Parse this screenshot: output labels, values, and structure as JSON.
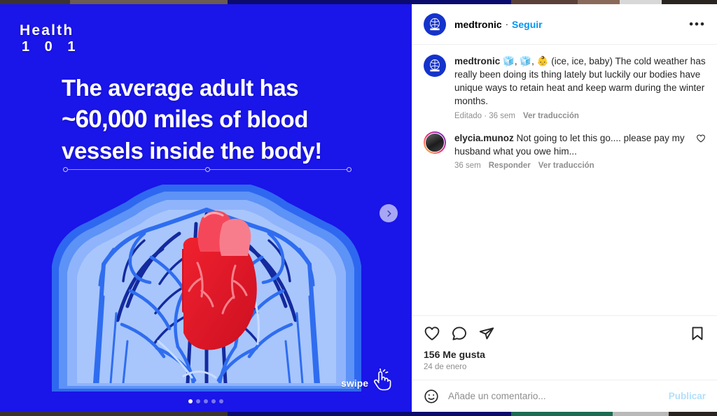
{
  "post": {
    "logo_line1": "Health",
    "logo_line2": "1 0 1",
    "headline_part1": "The average adult has",
    "headline_emphasis": "~60,000 miles",
    "headline_part2": " of blood",
    "headline_part3": "vessels inside the body!",
    "swipe_label": "swipe",
    "background_color": "#1a15e8",
    "heart_color": "#e8152b",
    "carousel": {
      "total": 5,
      "active_index": 0
    }
  },
  "header": {
    "username": "medtronic",
    "separator": "·",
    "follow_label": "Seguir",
    "more_label": "•••"
  },
  "caption": {
    "username": "medtronic",
    "text": "🧊, 🧊, 👶 (ice, ice, baby) The cold weather has really been doing its thing lately but luckily our bodies have unique ways to retain heat and keep warm during the winter months.",
    "edited_label": "Editado",
    "separator": "·",
    "time": "36 sem",
    "translate_label": "Ver traducción"
  },
  "comments": [
    {
      "username": "elycia.munoz",
      "text": "Not going to let this go.... please pay my husband what you owe him...",
      "time": "36 sem",
      "reply_label": "Responder",
      "translate_label": "Ver traducción"
    }
  ],
  "actions": {
    "like_icon": "heart-icon",
    "comment_icon": "comment-icon",
    "share_icon": "share-icon",
    "save_icon": "bookmark-icon",
    "likes": "156 Me gusta",
    "date": "24 de enero"
  },
  "add_comment": {
    "placeholder": "Añade un comentario...",
    "publish_label": "Publicar"
  }
}
